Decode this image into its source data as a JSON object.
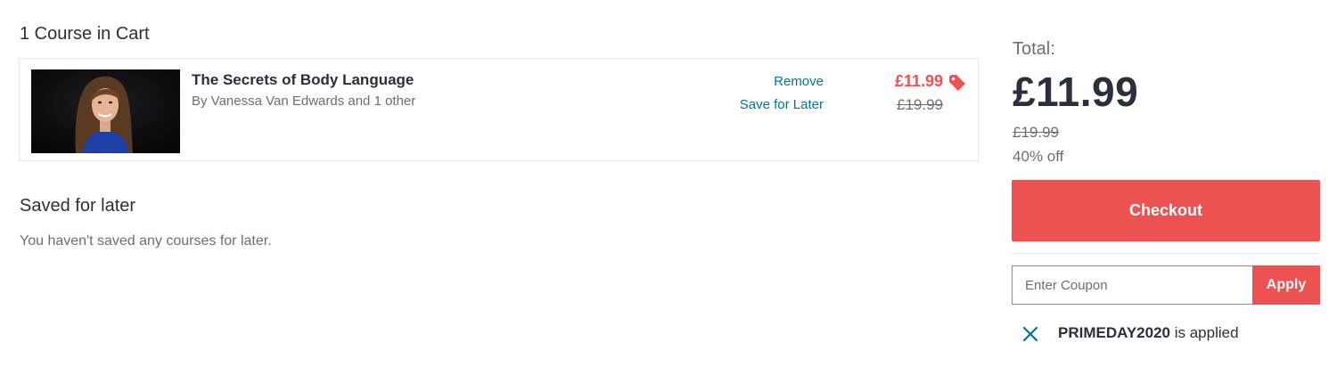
{
  "cart": {
    "heading": "1 Course in Cart",
    "items": [
      {
        "title": "The Secrets of Body Language",
        "author": "By Vanessa Van Edwards and 1 other",
        "remove_label": "Remove",
        "save_later_label": "Save for Later",
        "price": "£11.99",
        "original_price": "£19.99",
        "thumbnail_icon": "instructor-photo"
      }
    ]
  },
  "saved_for_later": {
    "heading": "Saved for later",
    "empty_message": "You haven't saved any courses for later."
  },
  "summary": {
    "total_label": "Total:",
    "total_price": "£11.99",
    "original_price": "£19.99",
    "discount": "40% off",
    "checkout_label": "Checkout"
  },
  "coupon": {
    "placeholder": "Enter Coupon",
    "apply_label": "Apply",
    "applied_code": "PRIMEDAY2020",
    "applied_suffix": " is applied"
  },
  "colors": {
    "accent": "#ec5252",
    "link": "#007791",
    "text": "#29303b",
    "muted": "#686f7a"
  }
}
